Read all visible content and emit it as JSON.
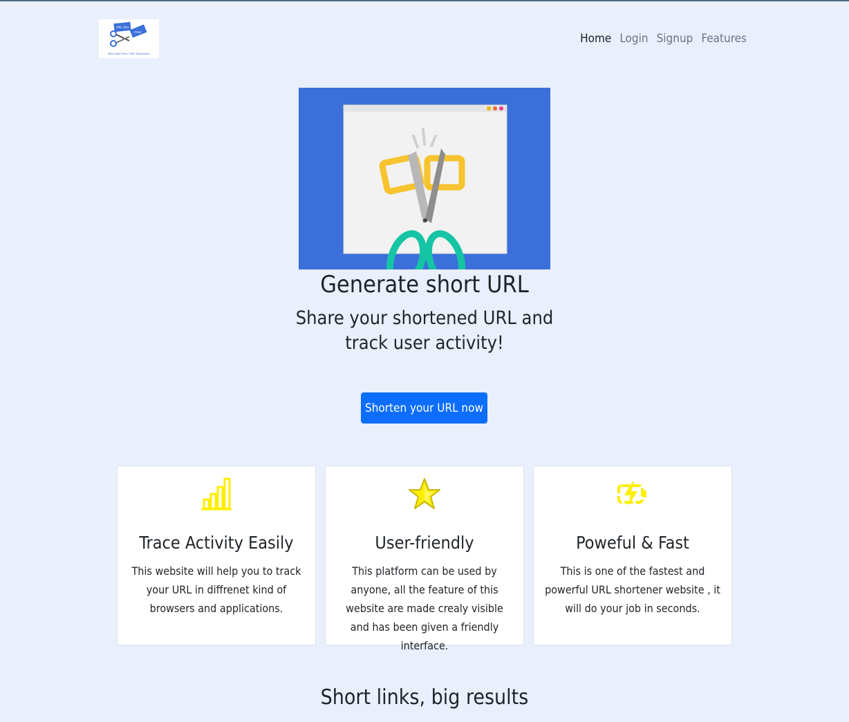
{
  "logo": {
    "tag_left": "URL Sho",
    "tag_right": "rtner",
    "caption": "Best and Free URL Shortener"
  },
  "nav": {
    "items": [
      {
        "label": "Home"
      },
      {
        "label": "Login"
      },
      {
        "label": "Signup"
      },
      {
        "label": "Features"
      }
    ]
  },
  "hero": {
    "title": "Generate short URL",
    "subtitle": "Share your shortened URL and track user activity!",
    "cta_label": "Shorten your URL now"
  },
  "features": [
    {
      "icon": "bar-chart-icon",
      "title": "Trace Activity Easily",
      "text": "This website will help you to track your URL in diffrenet kind of browsers and applications."
    },
    {
      "icon": "star-icon",
      "title": "User-friendly",
      "text": "This platform can be used by anyone, all the feature of this website are made crealy visible and has been given a friendly interface."
    },
    {
      "icon": "battery-charging-icon",
      "title": "Poweful & Fast",
      "text": "This is one of the fastest and powerful URL shortener website , it will do your job in seconds."
    }
  ],
  "section": {
    "title": "Short links, big results"
  },
  "colors": {
    "page_background": "#e9effb",
    "primary_button": "#0d6efd",
    "hero_background": "#3b6fd9",
    "icon_yellow": "#ffee00"
  }
}
